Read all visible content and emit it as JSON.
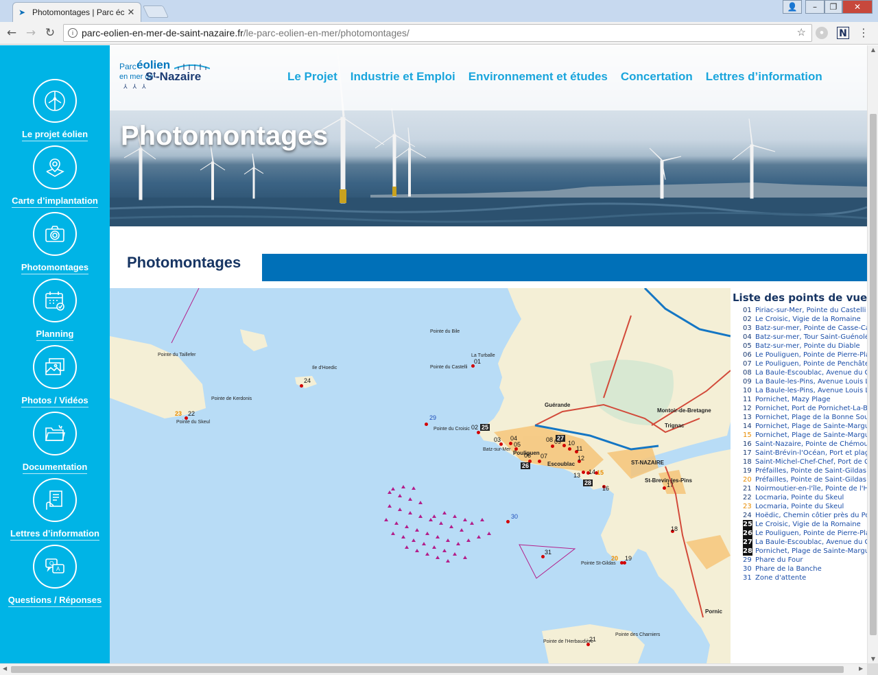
{
  "browser": {
    "tab_title": "Photomontages | Parc éc",
    "url_host": "parc-eolien-en-mer-de-saint-nazaire.fr",
    "url_path": "/le-parc-eolien-en-mer/photomontages/"
  },
  "sidebar": {
    "items": [
      {
        "label": "Le projet éolien",
        "icon": "wind-turbine-icon"
      },
      {
        "label": "Carte d’implantation",
        "icon": "map-pin-icon"
      },
      {
        "label": "Photomontages",
        "icon": "camera-icon"
      },
      {
        "label": "Planning",
        "icon": "calendar-icon"
      },
      {
        "label": "Photos / Vidéos",
        "icon": "photos-icon"
      },
      {
        "label": "Documentation",
        "icon": "folder-icon"
      },
      {
        "label": "Lettres d’information",
        "icon": "newsletter-icon"
      },
      {
        "label": "Questions / Réponses",
        "icon": "qa-icon"
      }
    ]
  },
  "logo": {
    "line1": "Parc",
    "line2": "éolien",
    "line3": "en mer de",
    "line4": "Sᵗ-Nazaire"
  },
  "nav": [
    "Le Projet",
    "Industrie et Emploi",
    "Environnement et études",
    "Concertation",
    "Lettres d’information"
  ],
  "hero_title": "Photomontages",
  "section_title": "Photomontages",
  "map": {
    "towns": [
      "Pointe du Castelli",
      "Pointe du Croisic",
      "Batz-sur-Mer",
      "Pouliguen",
      "Escoublac",
      "Guérande",
      "Montoir-de-Bretagne",
      "Trignac",
      "ST-NAZAIRE",
      "St-Brevin-les-Pins",
      "Pornic",
      "Pointe St-Gildas",
      "Pointe de Kerdonis",
      "Pointe du Skeul",
      "Pointe du Taillefer",
      "Pointe de l'Herbaudière",
      "Pointe des Charniers",
      "Ile d'Hoedic",
      "Pointe du Bile",
      "La Turballe"
    ],
    "markers": [
      "01",
      "02",
      "03",
      "04",
      "05",
      "06",
      "07",
      "08",
      "09",
      "10",
      "11",
      "12",
      "13",
      "14",
      "15",
      "16",
      "17",
      "18",
      "19",
      "20",
      "21",
      "22",
      "23",
      "24",
      "25",
      "26",
      "27",
      "28",
      "29",
      "30",
      "31"
    ]
  },
  "list": {
    "title": "Liste des points de vue",
    "items": [
      {
        "num": "01",
        "text": "Piriac-sur-Mer, Pointe du Castelli",
        "style": "normal"
      },
      {
        "num": "02",
        "text": "Le Croisic, Vigie de la Romaine",
        "style": "normal"
      },
      {
        "num": "03",
        "text": "Batz-sur-mer, Pointe de Casse-Caillou",
        "style": "normal"
      },
      {
        "num": "04",
        "text": "Batz-sur-mer, Tour Saint-Guénolé",
        "style": "normal"
      },
      {
        "num": "05",
        "text": "Batz-sur-mer, Pointe du Diable",
        "style": "normal"
      },
      {
        "num": "06",
        "text": "Le Pouliguen, Pointe de Pierre-Plate",
        "style": "normal"
      },
      {
        "num": "07",
        "text": "Le Pouliguen, Pointe de Penchâteau",
        "style": "normal"
      },
      {
        "num": "08",
        "text": "La Baule-Escoublac, Avenue du Général",
        "style": "normal"
      },
      {
        "num": "09",
        "text": "La Baule-les-Pins, Avenue Louis Lajarrige",
        "style": "normal"
      },
      {
        "num": "10",
        "text": "La Baule-les-Pins, Avenue Louis Lajarrige",
        "style": "normal"
      },
      {
        "num": "11",
        "text": "Pornichet, Mazy Plage",
        "style": "normal"
      },
      {
        "num": "12",
        "text": "Pornichet, Port de Pornichet-La-Baule",
        "style": "normal"
      },
      {
        "num": "13",
        "text": "Pornichet, Plage de la Bonne Source",
        "style": "normal"
      },
      {
        "num": "14",
        "text": "Pornichet, Plage de Sainte-Marguerite",
        "style": "normal"
      },
      {
        "num": "15",
        "text": "Pornichet, Plage de Sainte-Marguerite",
        "style": "orange"
      },
      {
        "num": "16",
        "text": "Saint-Nazaire, Pointe de Chémoulin",
        "style": "normal"
      },
      {
        "num": "17",
        "text": "Saint-Brévin-l'Océan, Port et plage",
        "style": "normal"
      },
      {
        "num": "18",
        "text": "Saint-Michel-Chef-Chef, Port de Comberge",
        "style": "normal"
      },
      {
        "num": "19",
        "text": "Préfailles, Pointe de Saint-Gildas",
        "style": "normal"
      },
      {
        "num": "20",
        "text": "Préfailles, Pointe de Saint-Gildas",
        "style": "orange"
      },
      {
        "num": "21",
        "text": "Noirmoutier-en-l'île, Pointe de l'Herbaudière",
        "style": "normal"
      },
      {
        "num": "22",
        "text": "Locmaria, Pointe du Skeul",
        "style": "normal"
      },
      {
        "num": "23",
        "text": "Locmaria, Pointe du Skeul",
        "style": "orange"
      },
      {
        "num": "24",
        "text": "Hoëdic, Chemin côtier près du Port",
        "style": "normal"
      },
      {
        "num": "25",
        "text": "Le Croisic, Vigie de la Romaine",
        "style": "dark"
      },
      {
        "num": "26",
        "text": "Le Pouliguen, Pointe de Pierre-Plate",
        "style": "dark"
      },
      {
        "num": "27",
        "text": "La Baule-Escoublac, Avenue du Général",
        "style": "dark"
      },
      {
        "num": "28",
        "text": "Pornichet, Plage de Sainte-Marguerite",
        "style": "dark"
      },
      {
        "num": "29",
        "text": "Phare du Four",
        "style": "blue"
      },
      {
        "num": "30",
        "text": "Phare de la Banche",
        "style": "blue"
      },
      {
        "num": "31",
        "text": "Zone d'attente",
        "style": "blue"
      }
    ]
  },
  "colors": {
    "sidebar": "#00b4e6",
    "nav": "#1aa5dc",
    "title_bar": "#0070b8",
    "title_text": "#173563",
    "sea": "#b8dcf6",
    "marker": "#d20000"
  }
}
